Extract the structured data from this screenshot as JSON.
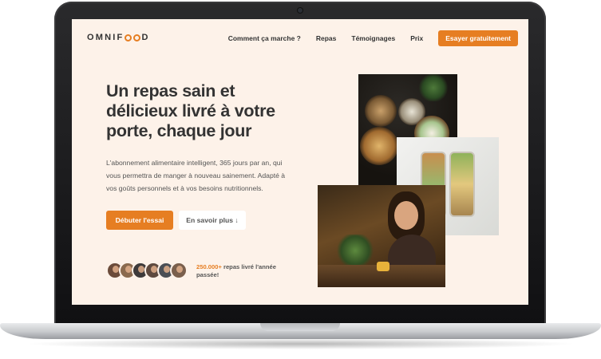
{
  "nav": {
    "logo_prefix": "OMNIF",
    "logo_suffix": "D",
    "items": [
      "Comment ça marche ?",
      "Repas",
      "Témoignages",
      "Prix"
    ],
    "cta": "Esayer gratuitement"
  },
  "hero": {
    "title": "Un repas sain et délicieux livré à votre porte, chaque jour",
    "description": "L'abonnement alimentaire intelligent, 365 jours par an, qui vous permettra de manger à nouveau sainement. Adapté à vos goûts personnels et à vos besoins nutritionnels.",
    "primary_button": "Débuter l'essai",
    "secondary_button": "En savoir plus ↓"
  },
  "delivered": {
    "count": "250.000+",
    "text": " repas livré l'année passée!"
  },
  "colors": {
    "accent": "#e67e22",
    "background": "#fdf2e9",
    "text": "#333333"
  }
}
